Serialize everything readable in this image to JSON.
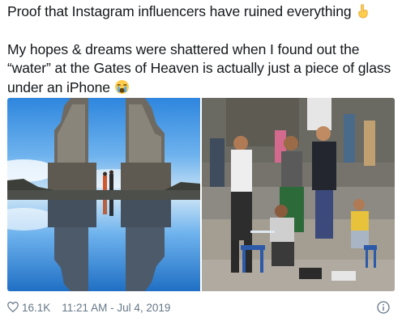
{
  "tweet": {
    "line1": "Proof that Instagram influencers have ruined everything",
    "line2": "My hopes & dreams were shattered when I found out the “water” at the Gates of Heaven is actually just a piece of glass under an iPhone",
    "emoji1": "pointing-down-hand-icon",
    "emoji2": "crying-face-icon"
  },
  "meta": {
    "likes": "16.1K",
    "timestamp": "11:21 AM - Jul 4, 2019"
  },
  "icons": {
    "like": "heart-icon",
    "info": "info-icon"
  },
  "colors": {
    "text": "#14171a",
    "meta": "#657786"
  }
}
